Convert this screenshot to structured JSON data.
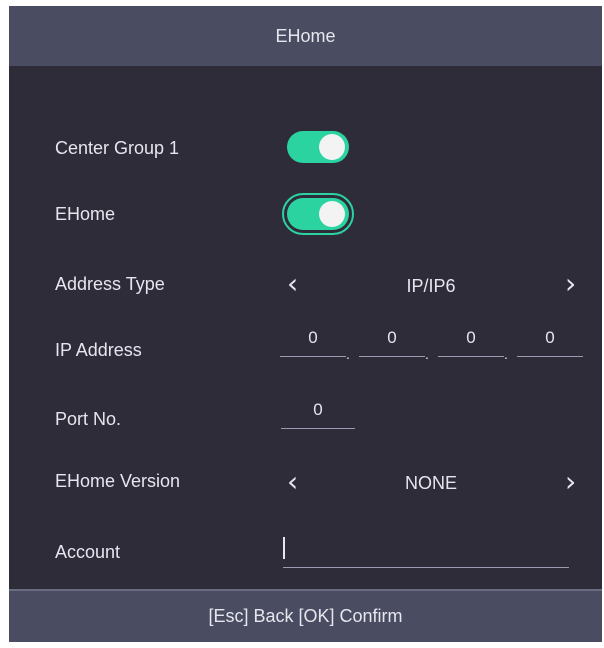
{
  "title": "EHome",
  "rows": {
    "center_group": {
      "label": "Center Group 1",
      "enabled": true
    },
    "ehome": {
      "label": "EHome",
      "enabled": true
    },
    "address_type": {
      "label": "Address Type",
      "value": "IP/IP6",
      "prev_icon": "chevron-left-icon",
      "next_icon": "chevron-right-icon"
    },
    "ip_address": {
      "label": "IP Address",
      "octets": [
        "0",
        "0",
        "0",
        "0"
      ]
    },
    "port": {
      "label": "Port No.",
      "value": "0"
    },
    "ehome_version": {
      "label": "EHome Version",
      "value": "NONE",
      "prev_icon": "chevron-left-icon",
      "next_icon": "chevron-right-icon"
    },
    "account": {
      "label": "Account",
      "value": ""
    }
  },
  "footer": {
    "text": "[Esc] Back [OK] Confirm"
  },
  "colors": {
    "background": "#2f2c3a",
    "bar": "#4a4d61",
    "toggle_on": "#2ad3a0",
    "text": "#e6e6ee"
  }
}
